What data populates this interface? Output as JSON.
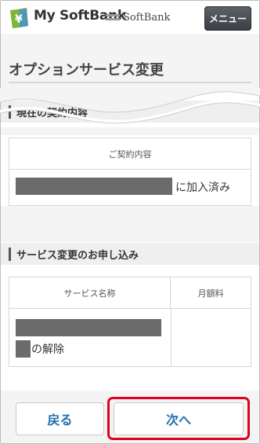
{
  "header": {
    "brand": "My SoftBank",
    "brand_sub": "SoftBank",
    "menu_label": "メニュー"
  },
  "page": {
    "title": "オプションサービス変更"
  },
  "current_contract": {
    "heading": "現在の契約内容",
    "column_header": "ご契約内容",
    "status_suffix": "に加入済み"
  },
  "service_change": {
    "heading": "サービス変更のお申し込み",
    "columns": [
      "サービス名称",
      "月額料"
    ],
    "row_suffix": "の解除",
    "monthly_fee": ""
  },
  "actions": {
    "back_label": "戻る",
    "next_label": "次へ"
  },
  "colors": {
    "highlight": "#e1001e",
    "link": "#1f6fb0"
  }
}
